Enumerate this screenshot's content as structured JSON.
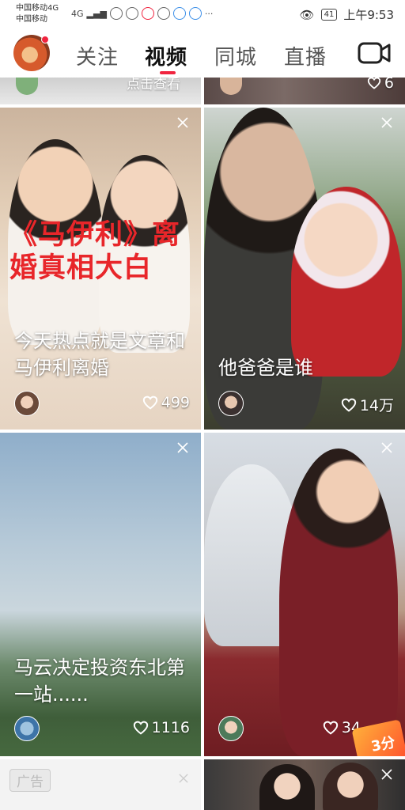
{
  "status_bar": {
    "carrier_1": "中国移动4G",
    "carrier_2": "中国移动",
    "network": "4G",
    "battery": "41",
    "time": "上午9:53",
    "more": "···"
  },
  "nav": {
    "tabs": [
      {
        "label": "关注"
      },
      {
        "label": "视频"
      },
      {
        "label": "同城"
      },
      {
        "label": "直播"
      }
    ],
    "active_tab": "视频",
    "accent": "#f0243f"
  },
  "feed": {
    "top_strip": {
      "left_text": "点击查看",
      "right_likes": "6"
    },
    "cards": [
      {
        "overlay_text": "《马伊利》离婚真相大白",
        "title": "今天热点就是文章和马伊利离婚",
        "likes": "499"
      },
      {
        "title": "他爸爸是谁",
        "likes": "14万"
      },
      {
        "title": "马云决定投资东北第一站......",
        "likes": "1116"
      },
      {
        "title": "",
        "likes": "34",
        "promo": "3分"
      },
      {
        "ad_label": "广告"
      },
      {}
    ]
  },
  "icons": {
    "like": "heart-outline-icon",
    "close": "close-icon",
    "camera": "video-camera-icon"
  }
}
